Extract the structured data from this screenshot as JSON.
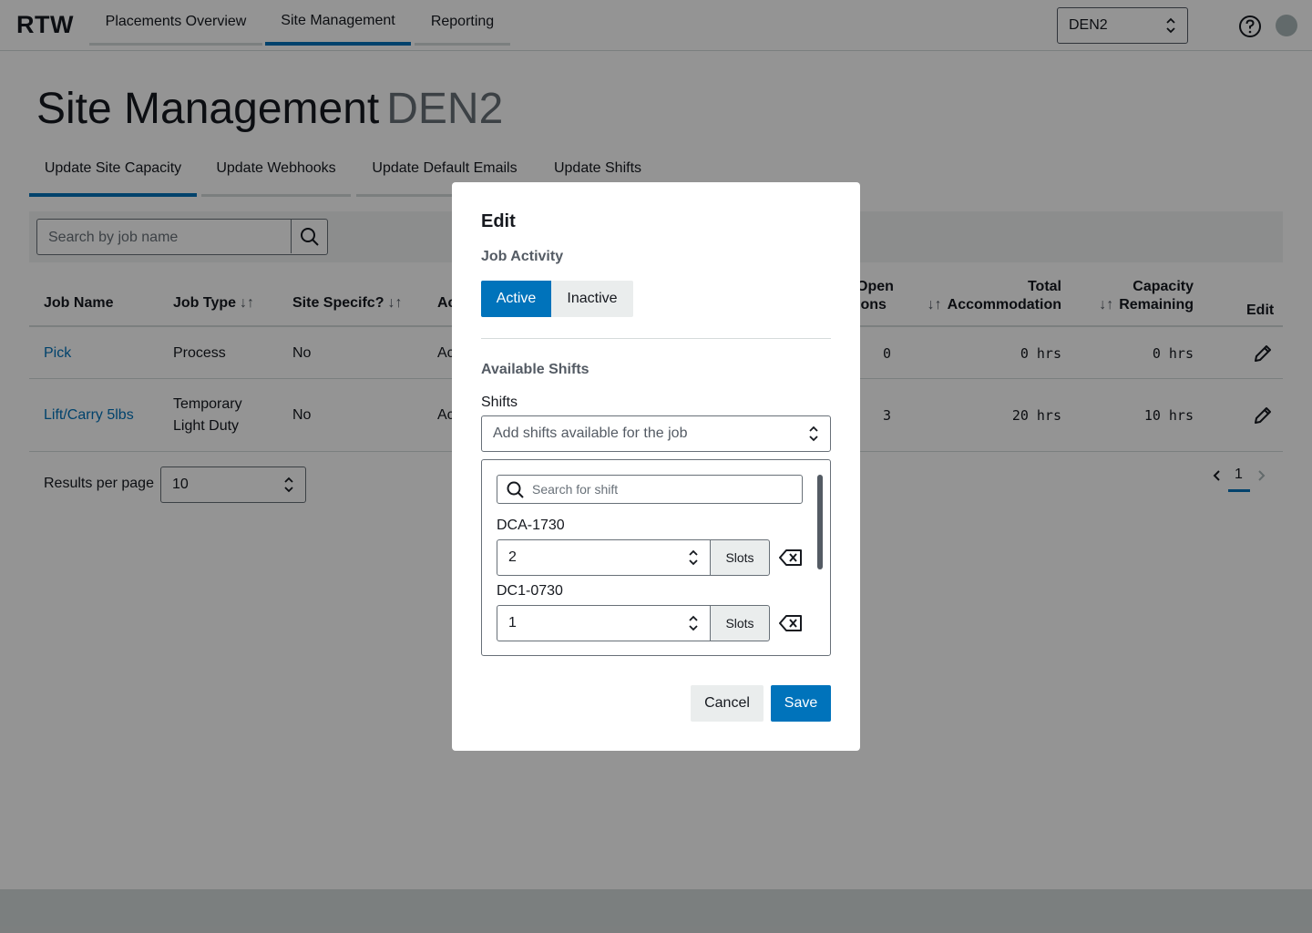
{
  "brand": "RTW",
  "nav": {
    "tabs": [
      {
        "label": "Placements Overview",
        "active": false
      },
      {
        "label": "Site Management",
        "active": true
      },
      {
        "label": "Reporting",
        "active": false
      }
    ],
    "site_select": "DEN2",
    "help_icon": "help-circle-icon",
    "avatar_icon": "user-avatar-icon"
  },
  "page": {
    "title": "Site Management",
    "site": "DEN2",
    "subtabs": [
      {
        "label": "Update Site Capacity",
        "active": true
      },
      {
        "label": "Update Webhooks",
        "active": false
      },
      {
        "label": "Update Default Emails",
        "active": false
      },
      {
        "label": "Update Shifts",
        "active": false
      }
    ],
    "search": {
      "placeholder": "Search by job name"
    },
    "table": {
      "columns": {
        "job_name": "Job Name",
        "job_type": "Job Type",
        "site_specific": "Site Specifc?",
        "active_partial": "Ac",
        "open_positions_line1": "Open",
        "open_positions_line2": "ions",
        "total_line1": "Total",
        "total_line2": "Accommodation",
        "capacity_line1": "Capacity",
        "capacity_line2": "Remaining",
        "edit": "Edit"
      },
      "rows": [
        {
          "job_name": "Pick",
          "job_type_line1": "Process",
          "job_type_line2": "",
          "site_specific": "No",
          "active": "Ac",
          "open": "0",
          "total": "0 hrs",
          "remaining": "0 hrs"
        },
        {
          "job_name": "Lift/Carry 5lbs",
          "job_type_line1": "Temporary",
          "job_type_line2": "Light Duty",
          "site_specific": "No",
          "active": "Ac",
          "open": "3",
          "total": "20 hrs",
          "remaining": "10 hrs"
        }
      ]
    },
    "pagination": {
      "results_per_page_label": "Results per page",
      "results_per_page": "10",
      "current_page": "1"
    }
  },
  "modal": {
    "title": "Edit",
    "job_activity_label": "Job Activity",
    "active_label": "Active",
    "inactive_label": "Inactive",
    "available_shifts_label": "Available Shifts",
    "shifts_label": "Shifts",
    "shifts_placeholder": "Add shifts available for the job",
    "shift_search_placeholder": "Search for shift",
    "shifts": [
      {
        "name": "DCA-1730",
        "slots": "2",
        "suffix": "Slots"
      },
      {
        "name": "DC1-0730",
        "slots": "1",
        "suffix": "Slots"
      }
    ],
    "cancel_label": "Cancel",
    "save_label": "Save"
  }
}
